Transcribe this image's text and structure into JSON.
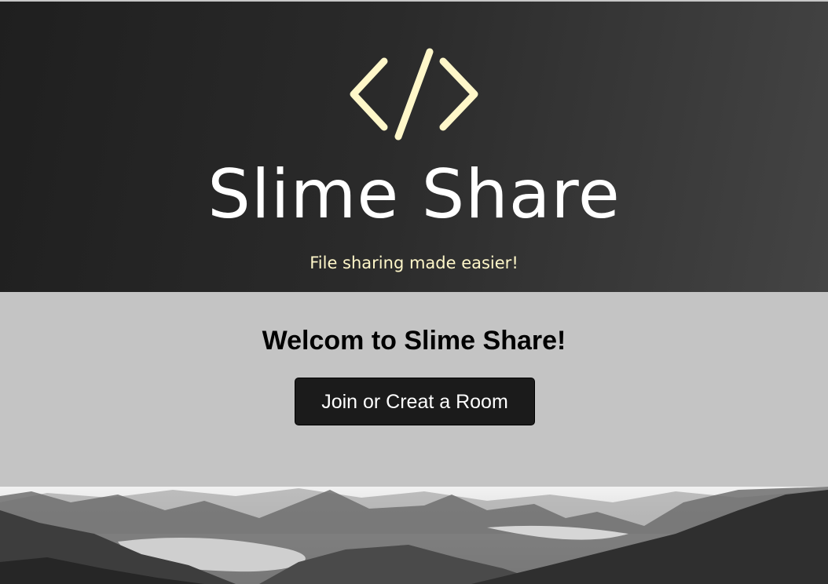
{
  "header": {
    "logo_icon": "code-brackets-icon",
    "title": "Slime Share",
    "tagline": "File sharing made easier!"
  },
  "main": {
    "welcome_heading": "Welcom to Slime Share!",
    "room_button_label": "Join or Creat a Room"
  },
  "footer": {
    "image": "misty-mountains-landscape"
  },
  "colors": {
    "hero_background": "#2a2a2a",
    "logo_accent": "#fff7c9",
    "page_background": "#c4c4c4",
    "button_background": "#1b1b1b",
    "button_text": "#ffffff"
  }
}
